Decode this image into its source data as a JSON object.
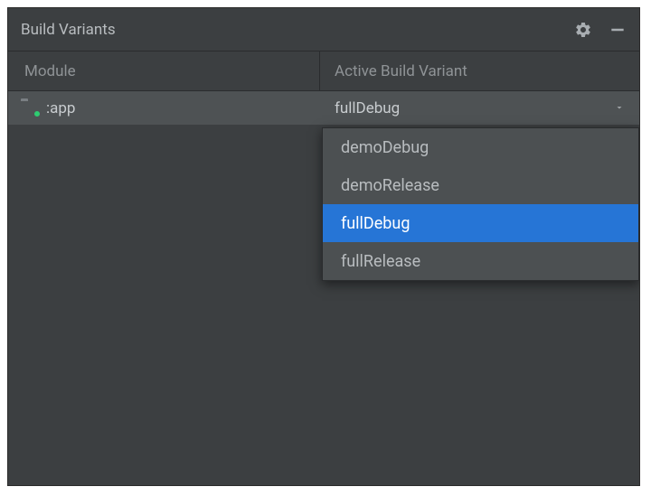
{
  "panel": {
    "title": "Build Variants"
  },
  "table": {
    "headers": {
      "module": "Module",
      "variant": "Active Build Variant"
    },
    "rows": [
      {
        "module": ":app",
        "variant": "fullDebug"
      }
    ]
  },
  "dropdown": {
    "options": [
      {
        "label": "demoDebug",
        "selected": false
      },
      {
        "label": "demoRelease",
        "selected": false
      },
      {
        "label": "fullDebug",
        "selected": true
      },
      {
        "label": "fullRelease",
        "selected": false
      }
    ]
  }
}
